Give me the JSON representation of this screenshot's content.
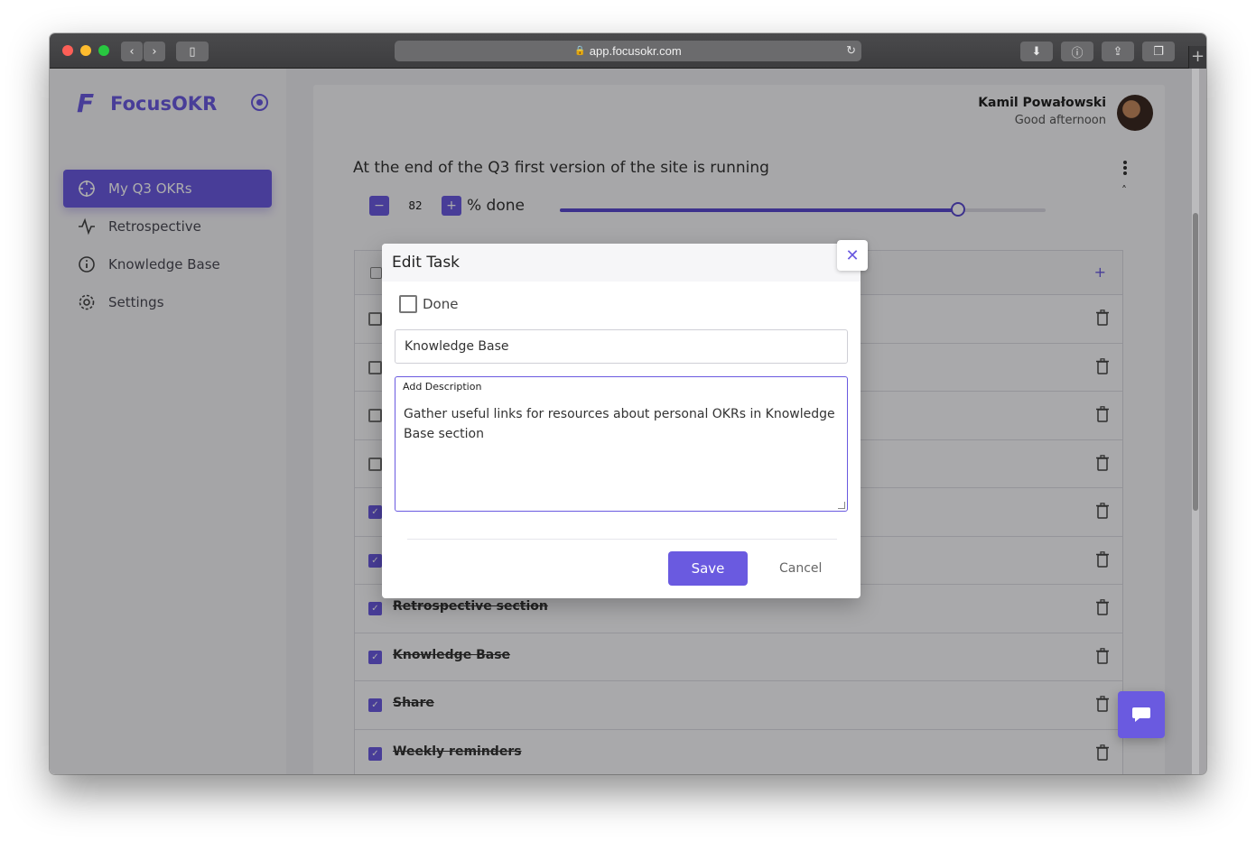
{
  "browser": {
    "url": "app.focusokr.com"
  },
  "sidebar": {
    "brand": "FocusOKR",
    "brand_logo": "F",
    "items": [
      {
        "label": "My Q3 OKRs",
        "icon": "crosshair-icon",
        "active": true
      },
      {
        "label": "Retrospective",
        "icon": "activity-icon",
        "active": false
      },
      {
        "label": "Knowledge Base",
        "icon": "info-icon",
        "active": false
      },
      {
        "label": "Settings",
        "icon": "gear-icon",
        "active": false
      }
    ]
  },
  "header": {
    "user_name": "Kamil Powałowski",
    "greeting": "Good afternoon"
  },
  "okr": {
    "title": "At the end of the Q3 first version of the site is running",
    "progress_value": "82",
    "progress_fraction": 0.82,
    "progress_label": "% done",
    "tasks": [
      {
        "label": "",
        "done": false
      },
      {
        "label": "",
        "done": false
      },
      {
        "label": "",
        "done": false
      },
      {
        "label": "",
        "done": false
      },
      {
        "label": "",
        "done": true
      },
      {
        "label": "",
        "done": true
      },
      {
        "label": "Retrospective section",
        "done": true
      },
      {
        "label": "Knowledge Base",
        "done": true
      },
      {
        "label": "Share",
        "done": true
      },
      {
        "label": "Weekly reminders",
        "done": true
      }
    ]
  },
  "modal": {
    "title": "Edit Task",
    "done_label": "Done",
    "name_value": "Knowledge Base",
    "description_label": "Add Description",
    "description_value": "Gather useful links for resources about personal OKRs in Knowledge Base section",
    "save_label": "Save",
    "cancel_label": "Cancel",
    "close_glyph": "✕"
  },
  "colors": {
    "accent": "#6a5ae0"
  }
}
